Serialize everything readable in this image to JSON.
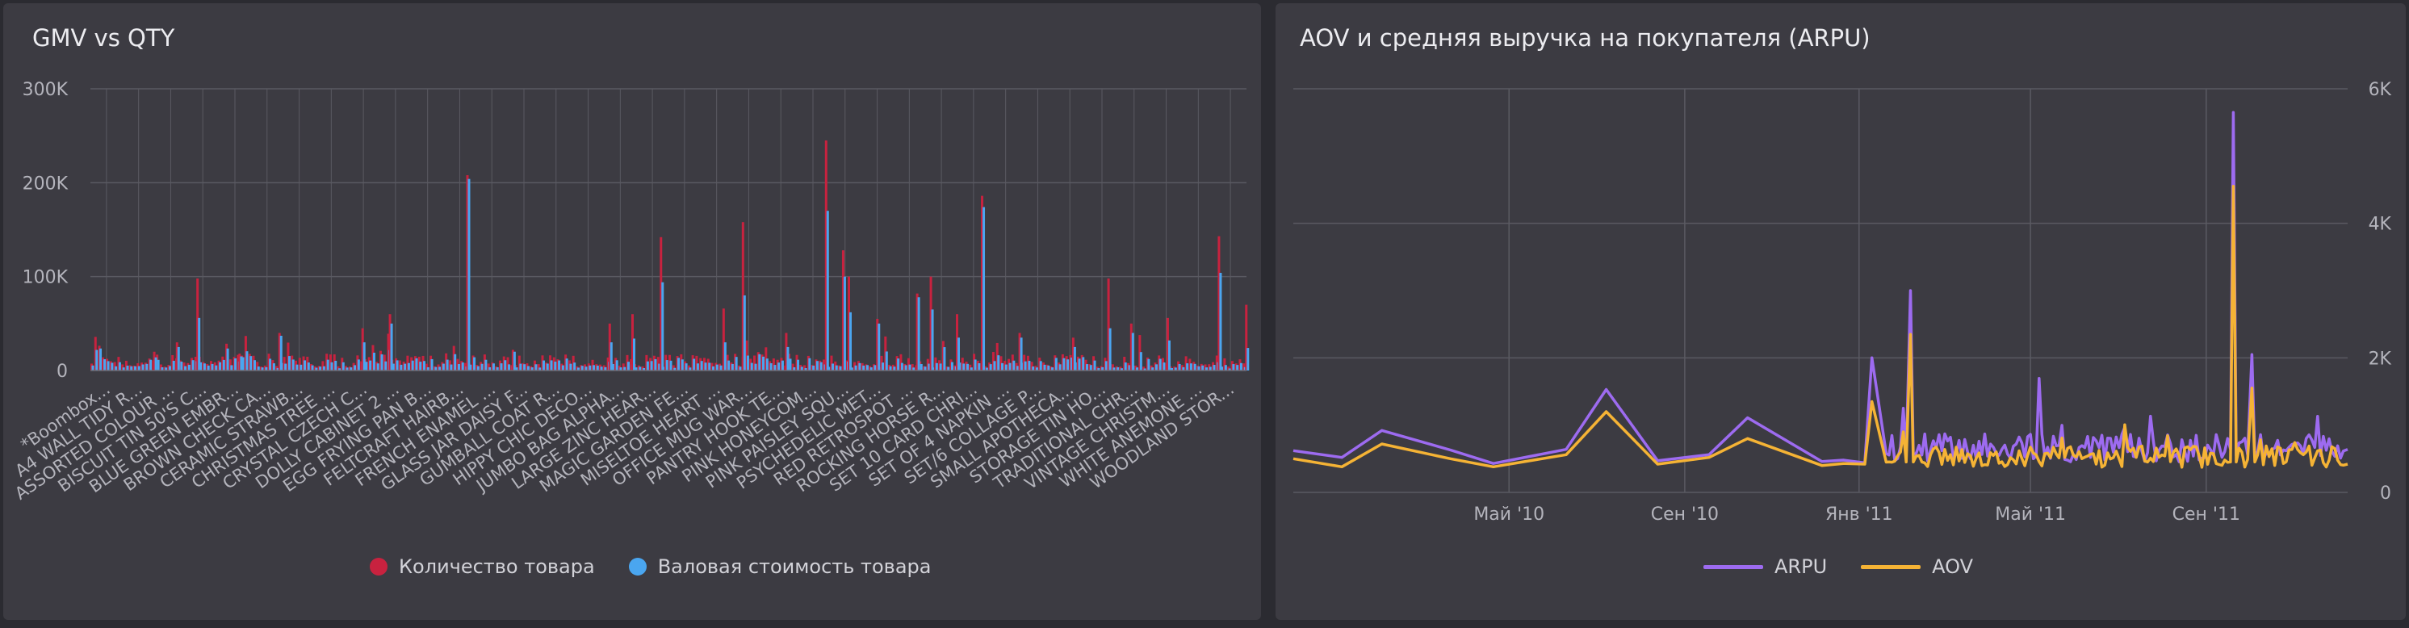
{
  "colors": {
    "qty": "#c8223f",
    "gmv": "#4aa6f0",
    "arpu": "#9d6bf0",
    "aov": "#f5b335",
    "grid": "#5a5a62",
    "axis_text": "#b4b4bc"
  },
  "chart_data": [
    {
      "type": "bar",
      "title": "GMV vs QTY",
      "xlabel": "",
      "ylabel": "",
      "ylim": [
        0,
        300000
      ],
      "y_ticks": [
        {
          "value": 0,
          "label": "0"
        },
        {
          "value": 100000,
          "label": "100K"
        },
        {
          "value": 200000,
          "label": "200K"
        },
        {
          "value": 300000,
          "label": "300K"
        }
      ],
      "category_labels": [
        "*Boombox...",
        "A4 WALL TIDY R...",
        "ASSORTED COLOUR ...",
        "BISCUIT TIN 50'S C...",
        "BLUE GREEN EMBR...",
        "BROWN CHECK CA...",
        "CERAMIC STRAWB...",
        "CHRISTMAS TREE ...",
        "CRYSTAL CZECH C...",
        "DOLLY CABINET 2 ...",
        "EGG FRYING PAN B...",
        "FELTCRAFT HAIRB...",
        "FRENCH ENAMEL ...",
        "GLASS JAR DAISY F...",
        "GUMBALL COAT R...",
        "HIPPY CHIC DECO...",
        "JUMBO BAG ALPHA...",
        "LARGE ZINC HEAR...",
        "MAGIC GARDEN FE...",
        "MISELTOE HEART ...",
        "OFFICE MUG WAR...",
        "PANTRY HOOK TE...",
        "PINK HONEYCOM...",
        "PINK PAISLEY SQU...",
        "PSYCHEDELIC MET...",
        "RED RETROSPOT ...",
        "ROCKING HORSE R...",
        "SET 10 CARD CHRI...",
        "SET OF 4 NAPKIN ...",
        "SET/6 COLLAGE P...",
        "SMALL APOTHECA...",
        "STORAGE TIN HO...",
        "TRADITIONAL CHR...",
        "VINTAGE CHRISTM...",
        "WHITE ANEMONE ...",
        "WOODLAND STOR..."
      ],
      "series": [
        {
          "name": "Количество товара",
          "peaks": [
            {
              "x": 0.01,
              "value": 14000
            },
            {
              "x": 0.055,
              "value": 20000
            },
            {
              "x": 0.075,
              "value": 30000
            },
            {
              "x": 0.093,
              "value": 98000
            },
            {
              "x": 0.13,
              "value": 18000
            },
            {
              "x": 0.165,
              "value": 40000
            },
            {
              "x": 0.238,
              "value": 45000
            },
            {
              "x": 0.262,
              "value": 60000
            },
            {
              "x": 0.33,
              "value": 208000
            },
            {
              "x": 0.37,
              "value": 22000
            },
            {
              "x": 0.455,
              "value": 50000
            },
            {
              "x": 0.475,
              "value": 60000
            },
            {
              "x": 0.5,
              "value": 142000
            },
            {
              "x": 0.555,
              "value": 66000
            },
            {
              "x": 0.572,
              "value": 158000
            },
            {
              "x": 0.61,
              "value": 40000
            },
            {
              "x": 0.645,
              "value": 245000
            },
            {
              "x": 0.66,
              "value": 128000
            },
            {
              "x": 0.665,
              "value": 100000
            },
            {
              "x": 0.69,
              "value": 55000
            },
            {
              "x": 0.725,
              "value": 82000
            },
            {
              "x": 0.737,
              "value": 100000
            },
            {
              "x": 0.76,
              "value": 60000
            },
            {
              "x": 0.782,
              "value": 186000
            },
            {
              "x": 0.815,
              "value": 40000
            },
            {
              "x": 0.862,
              "value": 35000
            },
            {
              "x": 0.893,
              "value": 98000
            },
            {
              "x": 0.913,
              "value": 50000
            },
            {
              "x": 0.945,
              "value": 56000
            },
            {
              "x": 0.99,
              "value": 143000
            },
            {
              "x": 1.014,
              "value": 70000
            }
          ]
        },
        {
          "name": "Валовая стоимость товара",
          "peaks": [
            {
              "x": 0.01,
              "value": 12000
            },
            {
              "x": 0.055,
              "value": 14000
            },
            {
              "x": 0.075,
              "value": 25000
            },
            {
              "x": 0.093,
              "value": 56000
            },
            {
              "x": 0.13,
              "value": 15000
            },
            {
              "x": 0.165,
              "value": 37000
            },
            {
              "x": 0.238,
              "value": 30000
            },
            {
              "x": 0.262,
              "value": 50000
            },
            {
              "x": 0.33,
              "value": 204000
            },
            {
              "x": 0.37,
              "value": 20000
            },
            {
              "x": 0.455,
              "value": 30000
            },
            {
              "x": 0.475,
              "value": 34000
            },
            {
              "x": 0.5,
              "value": 94000
            },
            {
              "x": 0.555,
              "value": 30000
            },
            {
              "x": 0.572,
              "value": 80000
            },
            {
              "x": 0.61,
              "value": 25000
            },
            {
              "x": 0.645,
              "value": 170000
            },
            {
              "x": 0.66,
              "value": 100000
            },
            {
              "x": 0.665,
              "value": 62000
            },
            {
              "x": 0.69,
              "value": 50000
            },
            {
              "x": 0.725,
              "value": 78000
            },
            {
              "x": 0.737,
              "value": 65000
            },
            {
              "x": 0.76,
              "value": 35000
            },
            {
              "x": 0.782,
              "value": 174000
            },
            {
              "x": 0.815,
              "value": 35000
            },
            {
              "x": 0.862,
              "value": 25000
            },
            {
              "x": 0.893,
              "value": 45000
            },
            {
              "x": 0.913,
              "value": 40000
            },
            {
              "x": 0.945,
              "value": 32000
            },
            {
              "x": 0.99,
              "value": 104000
            },
            {
              "x": 1.014,
              "value": 24000
            }
          ]
        }
      ]
    },
    {
      "type": "line",
      "title": "AOV и средняя выручка на покупателя (ARPU)",
      "xlabel": "",
      "ylabel": "",
      "x_axis": "date",
      "xlim": [
        "2009-12-01",
        "2011-12-09"
      ],
      "ylim": [
        0,
        6000
      ],
      "y_axis_side": "right",
      "y_ticks": [
        {
          "value": 0,
          "label": "0"
        },
        {
          "value": 2000,
          "label": "2K"
        },
        {
          "value": 4000,
          "label": "4K"
        },
        {
          "value": 6000,
          "label": "6K"
        }
      ],
      "x_ticks": [
        {
          "x": "2010-05-01",
          "label": "Май '10"
        },
        {
          "x": "2010-09-01",
          "label": "Сен '10"
        },
        {
          "x": "2011-01-01",
          "label": "Янв '11"
        },
        {
          "x": "2011-05-01",
          "label": "Май '11"
        },
        {
          "x": "2011-09-01",
          "label": "Сен '11"
        }
      ],
      "series": [
        {
          "name": "ARPU",
          "key_points": [
            {
              "x": "2009-12-01",
              "y": 620
            },
            {
              "x": "2010-01-04",
              "y": 520
            },
            {
              "x": "2010-02-01",
              "y": 920
            },
            {
              "x": "2010-03-21",
              "y": 630
            },
            {
              "x": "2010-04-20",
              "y": 430
            },
            {
              "x": "2010-06-10",
              "y": 640
            },
            {
              "x": "2010-07-08",
              "y": 1530
            },
            {
              "x": "2010-08-13",
              "y": 470
            },
            {
              "x": "2010-09-18",
              "y": 560
            },
            {
              "x": "2010-10-15",
              "y": 1110
            },
            {
              "x": "2010-12-06",
              "y": 460
            },
            {
              "x": "2010-12-21",
              "y": 480
            },
            {
              "x": "2011-01-05",
              "y": 440
            },
            {
              "x": "2011-01-10",
              "y": 2000
            },
            {
              "x": "2011-01-20",
              "y": 580
            },
            {
              "x": "2011-02-01",
              "y": 1250
            },
            {
              "x": "2011-02-06",
              "y": 3000
            },
            {
              "x": "2011-02-12",
              "y": 700
            },
            {
              "x": "2011-09-20",
              "y": 5650
            },
            {
              "x": "2011-10-03",
              "y": 2050
            },
            {
              "x": "2011-12-09",
              "y": 640
            }
          ]
        },
        {
          "name": "AOV",
          "key_points": [
            {
              "x": "2009-12-01",
              "y": 500
            },
            {
              "x": "2010-01-04",
              "y": 380
            },
            {
              "x": "2010-02-01",
              "y": 720
            },
            {
              "x": "2010-03-21",
              "y": 500
            },
            {
              "x": "2010-04-20",
              "y": 380
            },
            {
              "x": "2010-06-10",
              "y": 560
            },
            {
              "x": "2010-07-08",
              "y": 1200
            },
            {
              "x": "2010-08-13",
              "y": 420
            },
            {
              "x": "2010-09-18",
              "y": 520
            },
            {
              "x": "2010-10-15",
              "y": 800
            },
            {
              "x": "2010-12-06",
              "y": 400
            },
            {
              "x": "2010-12-21",
              "y": 430
            },
            {
              "x": "2011-01-05",
              "y": 420
            },
            {
              "x": "2011-01-10",
              "y": 1350
            },
            {
              "x": "2011-01-20",
              "y": 450
            },
            {
              "x": "2011-02-01",
              "y": 900
            },
            {
              "x": "2011-02-06",
              "y": 2350
            },
            {
              "x": "2011-02-12",
              "y": 550
            },
            {
              "x": "2011-09-20",
              "y": 4550
            },
            {
              "x": "2011-10-03",
              "y": 1550
            },
            {
              "x": "2011-12-09",
              "y": 420
            }
          ]
        }
      ]
    }
  ]
}
